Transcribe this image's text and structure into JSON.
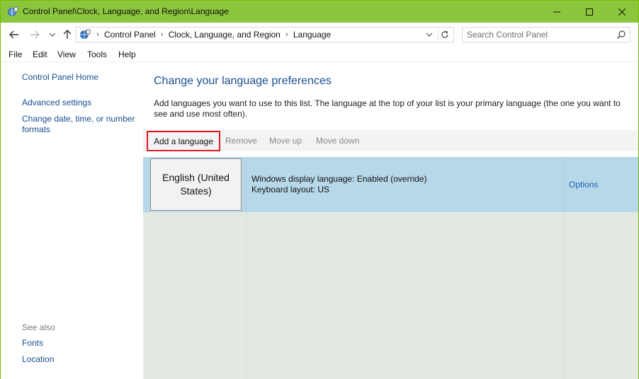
{
  "window": {
    "title": "Control Panel\\Clock, Language, and Region\\Language",
    "colors": {
      "titlebar": "#8cc63e",
      "accent_link": "#1a62b3",
      "highlight": "#e01b24"
    }
  },
  "address": {
    "crumbs": [
      "Control Panel",
      "Clock, Language, and Region",
      "Language"
    ],
    "search_placeholder": "Search Control Panel"
  },
  "menu": [
    "File",
    "Edit",
    "View",
    "Tools",
    "Help"
  ],
  "sidebar": {
    "home": "Control Panel Home",
    "links": [
      "Advanced settings",
      "Change date, time, or number formats"
    ],
    "see_also_label": "See also",
    "see_also": [
      "Fonts",
      "Location"
    ]
  },
  "main": {
    "heading": "Change your language preferences",
    "description": "Add languages you want to use to this list. The language at the top of your list is your primary language (the one you want to see and use most often).",
    "toolbar": {
      "add": "Add a language",
      "remove": "Remove",
      "move_up": "Move up",
      "move_down": "Move down"
    },
    "languages": [
      {
        "name": "English (United States)",
        "display_status": "Windows display language: Enabled (override)",
        "keyboard": "Keyboard layout: US",
        "options": "Options"
      }
    ]
  }
}
